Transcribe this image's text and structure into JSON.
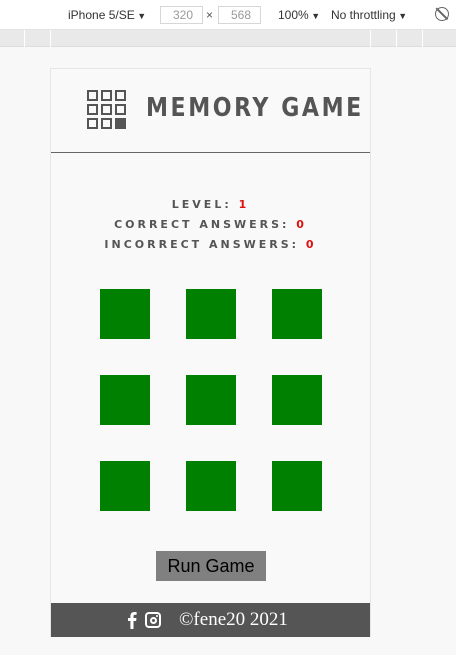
{
  "devtools": {
    "device": "iPhone 5/SE",
    "width": "320",
    "height": "568",
    "separator": "×",
    "zoom": "100%",
    "throttling": "No throttling"
  },
  "header": {
    "title": "MEMORY GAME"
  },
  "stats": {
    "level_label": "LEVEL:",
    "level_value": "1",
    "correct_label": "CORRECT ANSWERS:",
    "correct_value": "0",
    "incorrect_label": "INCORRECT ANSWERS:",
    "incorrect_value": "0"
  },
  "run_button": {
    "label": "Run Game"
  },
  "footer": {
    "copyright": "©fene20 2021"
  },
  "colors": {
    "tile": "#008000",
    "stat_value": "#dd1111",
    "footer_bg": "#555555",
    "button_bg": "#808080"
  }
}
